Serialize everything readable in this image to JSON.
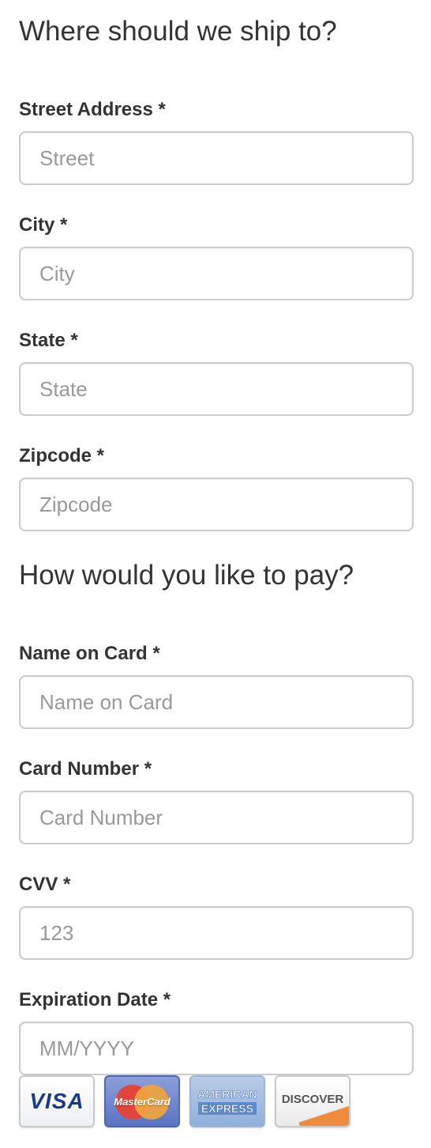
{
  "shipping": {
    "heading": "Where should we ship to?",
    "street": {
      "label": "Street Address *",
      "placeholder": "Street",
      "value": ""
    },
    "city": {
      "label": "City *",
      "placeholder": "City",
      "value": ""
    },
    "state": {
      "label": "State *",
      "placeholder": "State",
      "value": ""
    },
    "zipcode": {
      "label": "Zipcode *",
      "placeholder": "Zipcode",
      "value": ""
    }
  },
  "payment": {
    "heading": "How would you like to pay?",
    "name_on_card": {
      "label": "Name on Card *",
      "placeholder": "Name on Card",
      "value": ""
    },
    "card_number": {
      "label": "Card Number *",
      "placeholder": "Card Number",
      "value": ""
    },
    "cvv": {
      "label": "CVV *",
      "placeholder": "123",
      "value": ""
    },
    "expiration": {
      "label": "Expiration Date *",
      "placeholder": "MM/YYYY",
      "value": ""
    }
  },
  "card_logos": {
    "visa": {
      "icon": "visa-card-icon",
      "text": "VISA"
    },
    "mastercard": {
      "icon": "mastercard-card-icon",
      "text": "MasterCard"
    },
    "amex": {
      "icon": "american-express-card-icon",
      "line1": "AMERICAN",
      "line2": "EXPRESS"
    },
    "discover": {
      "icon": "discover-card-icon",
      "text": "DISCOVER"
    }
  },
  "colors": {
    "text": "#333333",
    "placeholder": "#999999",
    "input_border": "#cccccc"
  }
}
